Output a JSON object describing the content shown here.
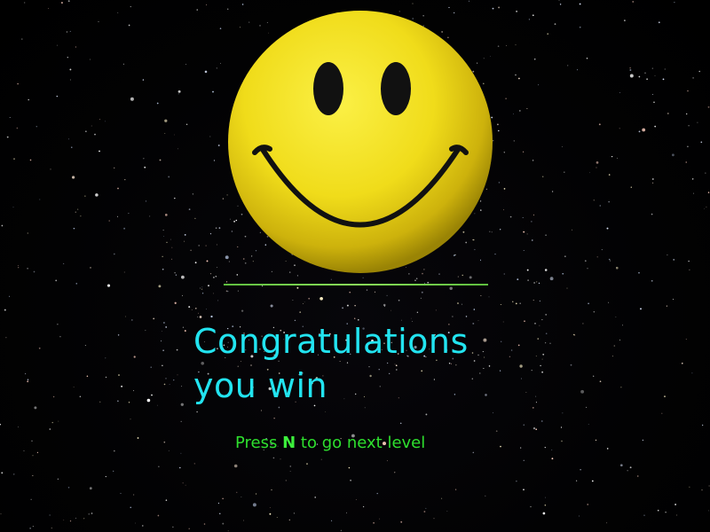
{
  "scene": {
    "background": "starfield",
    "emoji": "smiley-face"
  },
  "message": {
    "line1": "Congratulations",
    "line2": "you win"
  },
  "hint": {
    "prefix": "Press ",
    "key": "N",
    "suffix": " to go next level"
  },
  "colors": {
    "title": "#22e4f0",
    "hint": "#2ee02e",
    "smiley_face": "#f2e21c",
    "smiley_features": "#111111",
    "divider": "#7ad84f"
  }
}
